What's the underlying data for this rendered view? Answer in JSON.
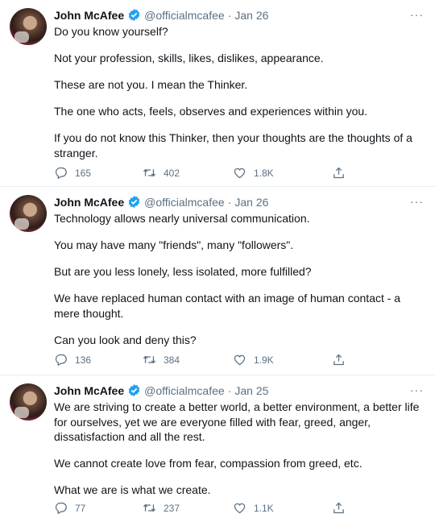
{
  "colors": {
    "verified": "#1da1f2",
    "secondary_text": "#5b7083",
    "text": "#0f1419"
  },
  "tweets": [
    {
      "name": "John McAfee",
      "handle": "@officialmcafee",
      "dot": "·",
      "date": "Jan 26",
      "more": "···",
      "paragraphs": [
        "Do you know yourself?",
        "Not your profession, skills, likes, dislikes, appearance.",
        "These are not you. I mean the Thinker.",
        "The one who acts, feels, observes and experiences within you.",
        "If you do not know this Thinker, then your thoughts are the thoughts of a stranger."
      ],
      "replies": "165",
      "retweets": "402",
      "likes": "1.8K"
    },
    {
      "name": "John McAfee",
      "handle": "@officialmcafee",
      "dot": "·",
      "date": "Jan 26",
      "more": "···",
      "paragraphs": [
        "Technology allows nearly universal communication.",
        "You may have many \"friends\", many \"followers\".",
        "But are you less lonely, less isolated, more fulfilled?",
        "We have replaced human contact with an image of human contact - a mere thought.",
        "Can you look and deny this?"
      ],
      "replies": "136",
      "retweets": "384",
      "likes": "1.9K"
    },
    {
      "name": "John McAfee",
      "handle": "@officialmcafee",
      "dot": "·",
      "date": "Jan 25",
      "more": "···",
      "paragraphs": [
        "We are striving to create a better world, a better environment, a better life for ourselves, yet we are everyone filled with fear, greed, anger, dissatisfaction and all the rest.",
        "We cannot create love from fear, compassion from greed, etc.",
        "What we are is what we create."
      ],
      "replies": "77",
      "retweets": "237",
      "likes": "1.1K"
    }
  ]
}
